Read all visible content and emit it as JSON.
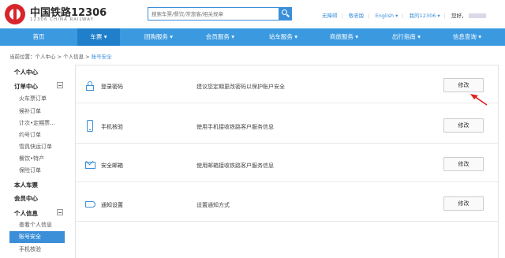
{
  "header": {
    "brand": "中国铁路12306",
    "brand_sub": "12306 CHINA RAILWAY",
    "search_placeholder": "搜索车票/餐饮/常旅客/相关规章",
    "links": [
      "无障碍",
      "敬老版",
      "English ▾",
      "我的12306 ▾"
    ],
    "greeting": "您好，"
  },
  "nav": {
    "items": [
      "首页",
      "车票 ▾",
      "团购服务 ▾",
      "会员服务 ▾",
      "站车服务 ▾",
      "商旅服务 ▾",
      "出行指南 ▾",
      "信息查询 ▾"
    ],
    "active_index": 1
  },
  "breadcrumb": {
    "prefix": "当前位置：个人中心 > 个人信息 > ",
    "current": "账号安全"
  },
  "sidebar": {
    "personal_center": "个人中心",
    "orders": "订单中心",
    "order_items": [
      "火车票订单",
      "候补订单",
      "计次•定期票...",
      "约号订单",
      "雪具快运订单",
      "餐饮•特产",
      "保险订单"
    ],
    "my_tickets": "本人车票",
    "membership": "会员中心",
    "personal_info": "个人信息",
    "info_items": [
      "查看个人信息",
      "账号安全",
      "手机核验"
    ],
    "active_item": "账号安全"
  },
  "settings": [
    {
      "title": "登录密码",
      "desc": "建议您定期更改密码以保护账户安全",
      "button": "修改",
      "icon": "lock-icon"
    },
    {
      "title": "手机核验",
      "desc": "使用手机接收铁路客户服务信息",
      "button": "修改",
      "icon": "phone-icon"
    },
    {
      "title": "安全邮箱",
      "desc": "使用邮箱接收铁路客户服务信息",
      "button": "修改",
      "icon": "mail-icon"
    },
    {
      "title": "通知设置",
      "desc": "设置通知方式",
      "button": "修改",
      "icon": "megaphone-icon"
    }
  ],
  "colors": {
    "nav_bg": "#3b99e0",
    "nav_active": "#1f7fcb",
    "accent": "#3b8fd9",
    "annotation_arrow": "#e02020"
  }
}
